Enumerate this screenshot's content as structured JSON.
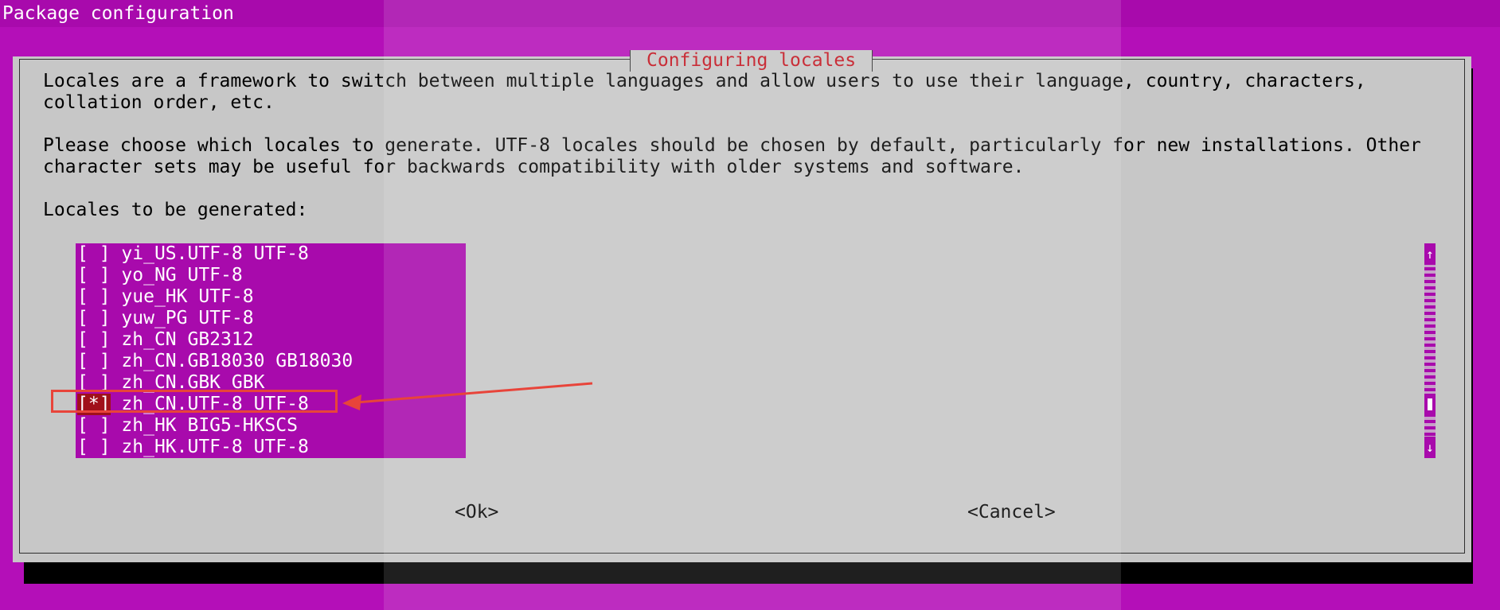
{
  "window": {
    "title": "Package configuration"
  },
  "dialog": {
    "title": "Configuring locales",
    "paragraph1_line1": "Locales are a framework to switch between multiple languages and allow users to use their language, country, characters,",
    "paragraph1_line2": "collation order, etc.",
    "paragraph2_line1": "Please choose which locales to generate. UTF-8 locales should be chosen by default, particularly for new installations. Other",
    "paragraph2_line2": "character sets may be useful for backwards compatibility with older systems and software.",
    "list_label": "Locales to be generated:"
  },
  "locales": [
    {
      "checkbox": "[ ]",
      "label": "yi_US.UTF-8 UTF-8",
      "checked": false
    },
    {
      "checkbox": "[ ]",
      "label": "yo_NG UTF-8",
      "checked": false
    },
    {
      "checkbox": "[ ]",
      "label": "yue_HK UTF-8",
      "checked": false
    },
    {
      "checkbox": "[ ]",
      "label": "yuw_PG UTF-8",
      "checked": false
    },
    {
      "checkbox": "[ ]",
      "label": "zh_CN GB2312",
      "checked": false
    },
    {
      "checkbox": "[ ]",
      "label": "zh_CN.GB18030 GB18030",
      "checked": false
    },
    {
      "checkbox": "[ ]",
      "label": "zh_CN.GBK GBK",
      "checked": false
    },
    {
      "checkbox": "[*]",
      "label": "zh_CN.UTF-8 UTF-8",
      "checked": true
    },
    {
      "checkbox": "[ ]",
      "label": "zh_HK BIG5-HKSCS",
      "checked": false
    },
    {
      "checkbox": "[ ]",
      "label": "zh_HK.UTF-8 UTF-8",
      "checked": false
    }
  ],
  "scrollbar": {
    "up_glyph": "↑",
    "down_glyph": "↓"
  },
  "buttons": {
    "ok": "<Ok>",
    "cancel": "<Cancel>"
  },
  "colors": {
    "background": "#b40fb8",
    "dialog": "#c7c7c7",
    "title_red": "#c2121d",
    "list_bg": "#a80aac",
    "annotation": "#e8443a"
  }
}
